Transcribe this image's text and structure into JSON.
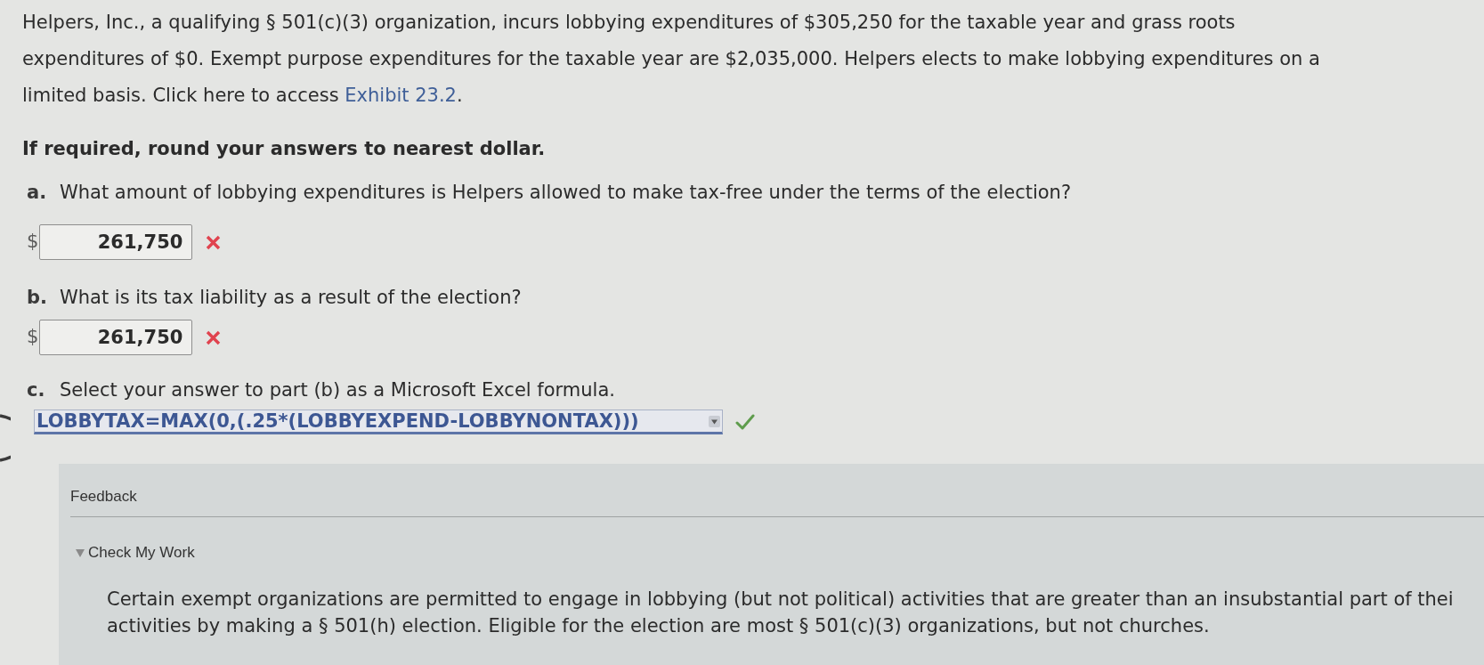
{
  "intro": {
    "text_before_link": "Helpers, Inc., a qualifying § 501(c)(3) organization, incurs lobbying expenditures of $305,250 for the taxable year and grass roots expenditures of $0. Exempt purpose expenditures for the taxable year are $2,035,000. Helpers elects to make lobbying expenditures on a limited basis. Click here to access ",
    "link": "Exhibit 23.2",
    "text_after_link": "."
  },
  "instruction": "If required, round your answers to nearest dollar.",
  "questions": [
    {
      "label": "a.",
      "text": "What amount of lobbying expenditures is Helpers allowed to make tax-free under the terms of the election?",
      "answer": {
        "kind": "amount",
        "currency": "$",
        "value": "261,750",
        "correct": false
      }
    },
    {
      "label": "b.",
      "text": "What is its tax liability as a result of the election?",
      "answer": {
        "kind": "amount",
        "currency": "$",
        "value": "261,750",
        "correct": false
      }
    },
    {
      "label": "c.",
      "text": "Select your answer to part (b) as a Microsoft Excel formula.",
      "answer": {
        "kind": "dropdown",
        "value": "LOBBYTAX=MAX(0,(.25*(LOBBYEXPEND-LOBBYNONTAX)))",
        "correct": true
      }
    }
  ],
  "feedback": {
    "title": "Feedback",
    "check_my_work": {
      "label": "Check My Work",
      "expanded": true
    },
    "explanation_lines": [
      "Certain exempt organizations are permitted to engage in lobbying (but not political) activities that are greater than an insubstantial part of thei",
      "activities by making a § 501(h) election. Eligible for the election are most § 501(c)(3) organizations, but not churches."
    ]
  }
}
